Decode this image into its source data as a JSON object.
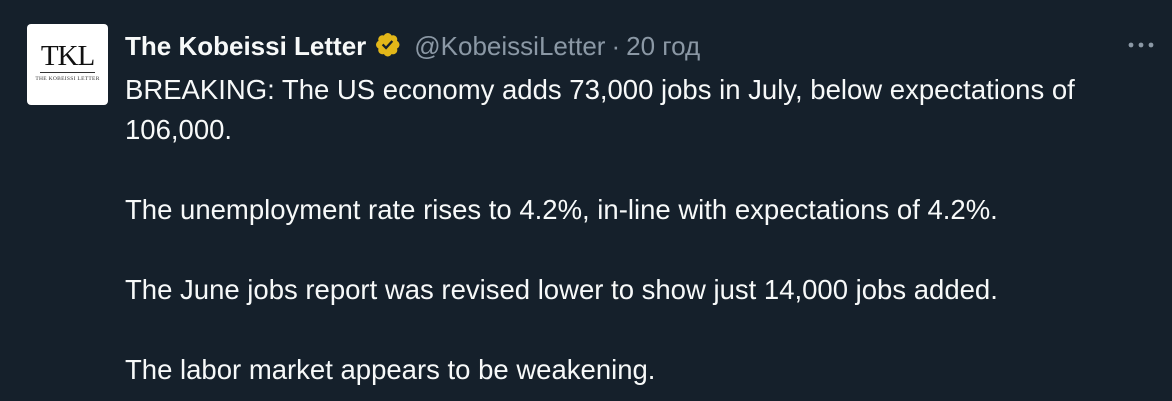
{
  "author": {
    "name": "The Kobeissi Letter",
    "handle": "@KobeissiLetter",
    "separator": "·",
    "time": "20 год",
    "verified_color": "#e2b719",
    "avatar_logo": {
      "letters": "TKL",
      "subtitle": "THE KOBEISSI LETTER"
    }
  },
  "more_menu": {
    "icon": "more-horizontal-icon"
  },
  "tweet": {
    "paragraphs": [
      "BREAKING: The US economy adds 73,000 jobs in July, below expectations of 106,000.",
      "The unemployment rate rises to 4.2%, in-line with expectations of 4.2%.",
      "The June jobs report was revised lower to show just 14,000 jobs added.",
      "The labor market appears to be weakening."
    ]
  },
  "colors": {
    "background": "#15202b",
    "text_primary": "#f7f9f9",
    "text_secondary": "#8b98a5"
  }
}
